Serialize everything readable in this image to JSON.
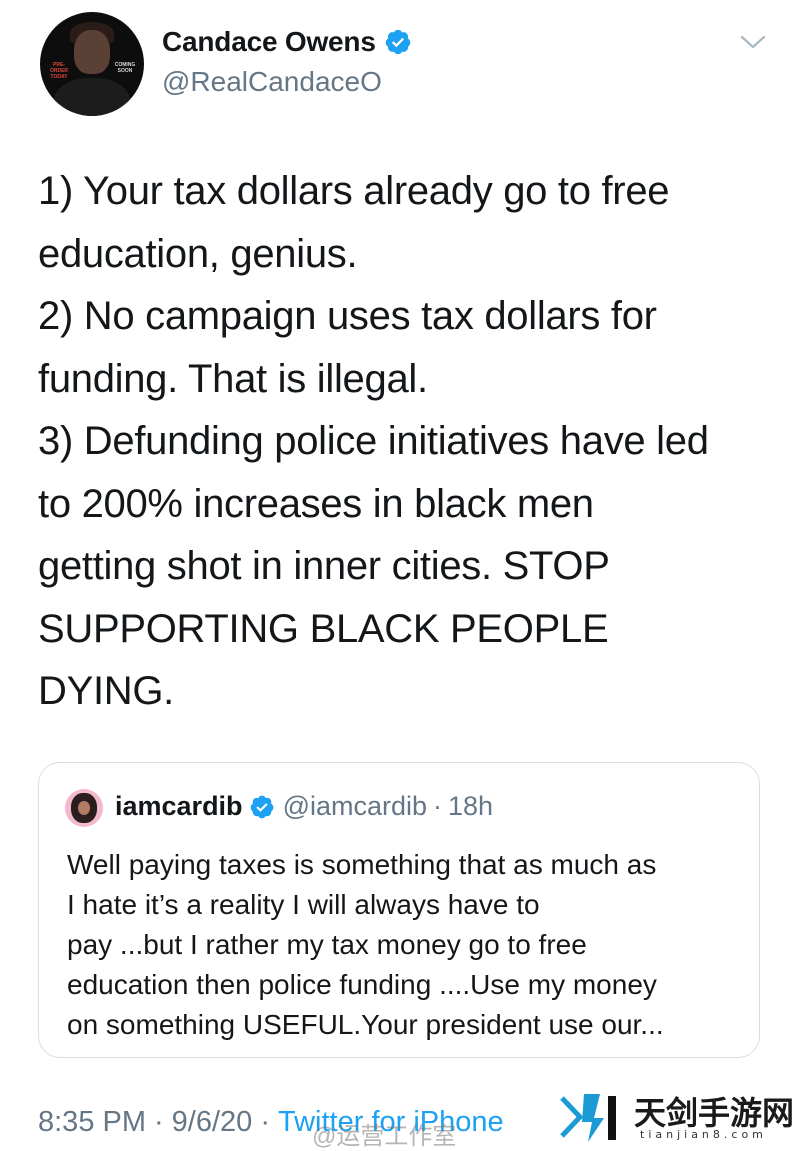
{
  "tweet": {
    "author": {
      "display_name": "Candace Owens",
      "handle": "@RealCandaceO",
      "verified": true,
      "avatar_text_left": "PRE-ORDER TODAY",
      "avatar_text_right": "COMING SOON"
    },
    "body_lines": [
      "1) Your tax dollars already go to free",
      "education, genius.",
      "2) No campaign uses tax dollars for",
      "funding. That is illegal.",
      "3) Defunding police initiatives have led",
      "to 200% increases in black men",
      "getting shot in inner cities. STOP",
      "SUPPORTING BLACK PEOPLE",
      "DYING."
    ],
    "quoted": {
      "display_name": "iamcardib",
      "handle": "@iamcardib",
      "separator": "·",
      "time": "18h",
      "verified": true,
      "text_lines": [
        "Well paying taxes is something that as much as",
        "I hate it’s a reality  I will always have to",
        "pay ...but I rather my tax money go to free",
        "education then police funding ....Use my money",
        "on something USEFUL.Your president use our..."
      ]
    },
    "meta": {
      "time": "8:35 PM",
      "separator": "·",
      "date": "9/6/20",
      "source": "Twitter for iPhone"
    }
  },
  "watermarks": {
    "weibo": "@运营工作室",
    "brand_name": "天剑手游网",
    "brand_url": "tianjian8.com"
  },
  "colors": {
    "text": "#14171a",
    "secondary": "#657786",
    "link": "#1da1f2",
    "verified": "#1da1f2",
    "border": "#d9dee2"
  },
  "icons": {
    "verified": "verified-badge-icon",
    "caret": "chevron-down-icon"
  }
}
